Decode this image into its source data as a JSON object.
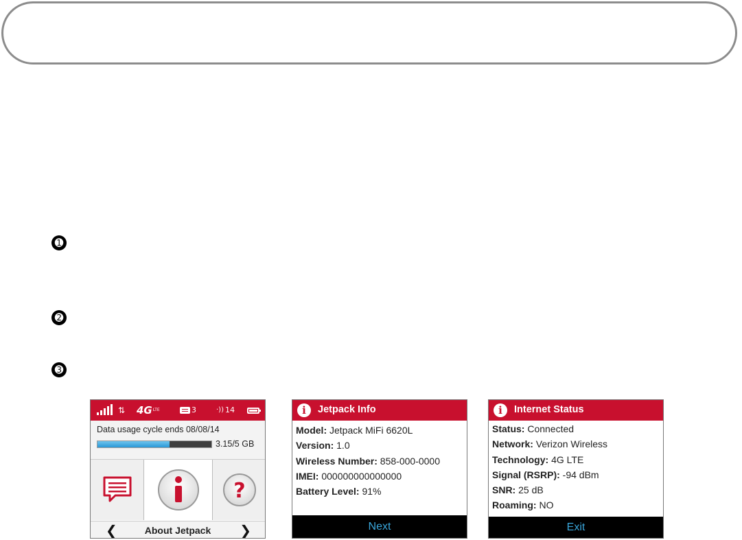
{
  "bullets": [
    "➊",
    "➋",
    "➌"
  ],
  "screen1": {
    "status_bar": {
      "network_type": "4G",
      "network_suffix": "LTE",
      "messages_count": "3",
      "connected_devices": "14"
    },
    "usage_text": "Data usage cycle ends 08/08/14",
    "usage_value": "3.15/5 GB",
    "usage_fraction": 0.63,
    "nav_label": "About Jetpack",
    "prev_arrow": "❮",
    "next_arrow": "❯",
    "icons": [
      "messages-icon",
      "info-icon",
      "help-icon"
    ]
  },
  "screen2": {
    "title": "Jetpack Info",
    "rows": [
      {
        "label": "Model:",
        "value": " Jetpack MiFi 6620L"
      },
      {
        "label": "Version:",
        "value": " 1.0"
      },
      {
        "label": "Wireless Number:",
        "value": " 858-000-0000"
      },
      {
        "label": "IMEI:",
        "value": " 000000000000000"
      },
      {
        "label": "Battery Level:",
        "value": " 91%"
      }
    ],
    "button": "Next"
  },
  "screen3": {
    "title": "Internet Status",
    "rows": [
      {
        "label": "Status:",
        "value": " Connected"
      },
      {
        "label": "Network:",
        "value": " Verizon Wireless"
      },
      {
        "label": "Technology:",
        "value": " 4G LTE"
      },
      {
        "label": "Signal (RSRP):",
        "value": " -94 dBm"
      },
      {
        "label": "SNR:",
        "value": " 25 dB"
      },
      {
        "label": "Roaming:",
        "value": " NO"
      }
    ],
    "button": "Exit"
  },
  "colors": {
    "brand_red": "#c8102e",
    "accent_blue": "#3aa7dc"
  }
}
